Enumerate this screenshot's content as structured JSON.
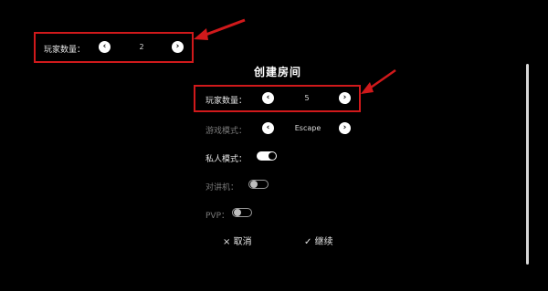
{
  "top_setting": {
    "label": "玩家数量：",
    "value": "2",
    "prev_icon": "chevron-left-icon",
    "next_icon": "chevron-right-icon"
  },
  "dialog": {
    "title": "创建房间",
    "player_count": {
      "label": "玩家数量：",
      "value": "5"
    },
    "game_mode": {
      "label": "游戏模式：",
      "value": "Escape"
    },
    "private_mode": {
      "label": "私人模式：",
      "enabled": true
    },
    "intercom": {
      "label": "对讲机：",
      "enabled": false
    },
    "pvp": {
      "label": "PVP：",
      "enabled": false
    },
    "cancel": {
      "icon": "×",
      "label": "取消"
    },
    "continue": {
      "icon": "✓",
      "label": "继续"
    }
  },
  "annotation_color": "#d0191b",
  "glyphs": {
    "prev": "‹",
    "next": "›"
  }
}
